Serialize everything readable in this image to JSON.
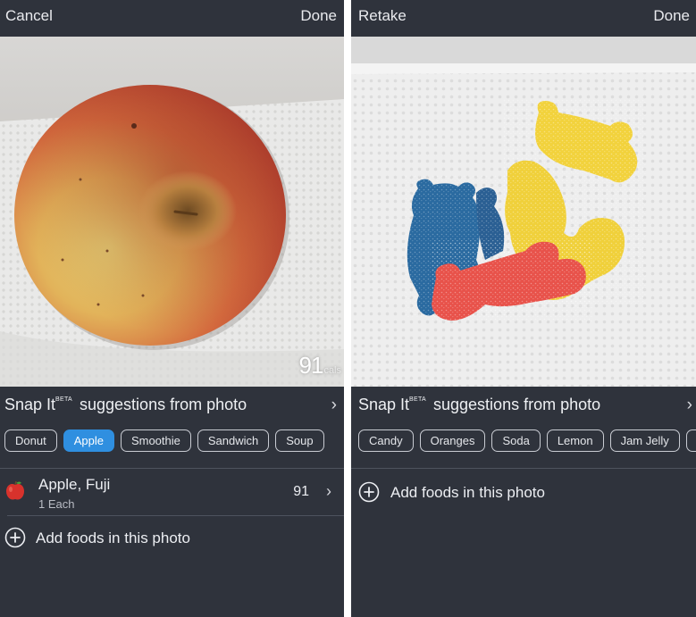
{
  "left": {
    "topbar": {
      "left_label": "Cancel",
      "right_label": "Done"
    },
    "photo": {
      "subject": "apple",
      "calories": "91",
      "calories_unit": "cals"
    },
    "snap": {
      "title_prefix": "Snap It",
      "beta": "BETA",
      "title_suffix": " suggestions from photo",
      "chevron": "›"
    },
    "chips": [
      {
        "label": "Donut",
        "selected": false
      },
      {
        "label": "Apple",
        "selected": true
      },
      {
        "label": "Smoothie",
        "selected": false
      },
      {
        "label": "Sandwich",
        "selected": false
      },
      {
        "label": "Soup",
        "selected": false
      }
    ],
    "food": {
      "name": "Apple, Fuji",
      "quantity": "1 Each",
      "calories": "91",
      "icon": "apple-icon",
      "chevron": "›"
    },
    "add": {
      "label": "Add foods in this photo",
      "icon": "plus-circle-icon"
    }
  },
  "right": {
    "topbar": {
      "left_label": "Retake",
      "right_label": "Done"
    },
    "photo": {
      "subject": "gummy candies"
    },
    "snap": {
      "title_prefix": "Snap It",
      "beta": "BETA",
      "title_suffix": " suggestions from photo",
      "chevron": "›"
    },
    "chips": [
      {
        "label": "Candy",
        "selected": false
      },
      {
        "label": "Oranges",
        "selected": false
      },
      {
        "label": "Soda",
        "selected": false
      },
      {
        "label": "Lemon",
        "selected": false
      },
      {
        "label": "Jam Jelly",
        "selected": false
      }
    ],
    "add": {
      "label": "Add foods in this photo",
      "icon": "plus-circle-icon"
    }
  },
  "colors": {
    "panel_bg": "#2f333c",
    "accent": "#2f8fe0",
    "chip_border": "#c9ccd3",
    "divider": "#4e535e"
  }
}
